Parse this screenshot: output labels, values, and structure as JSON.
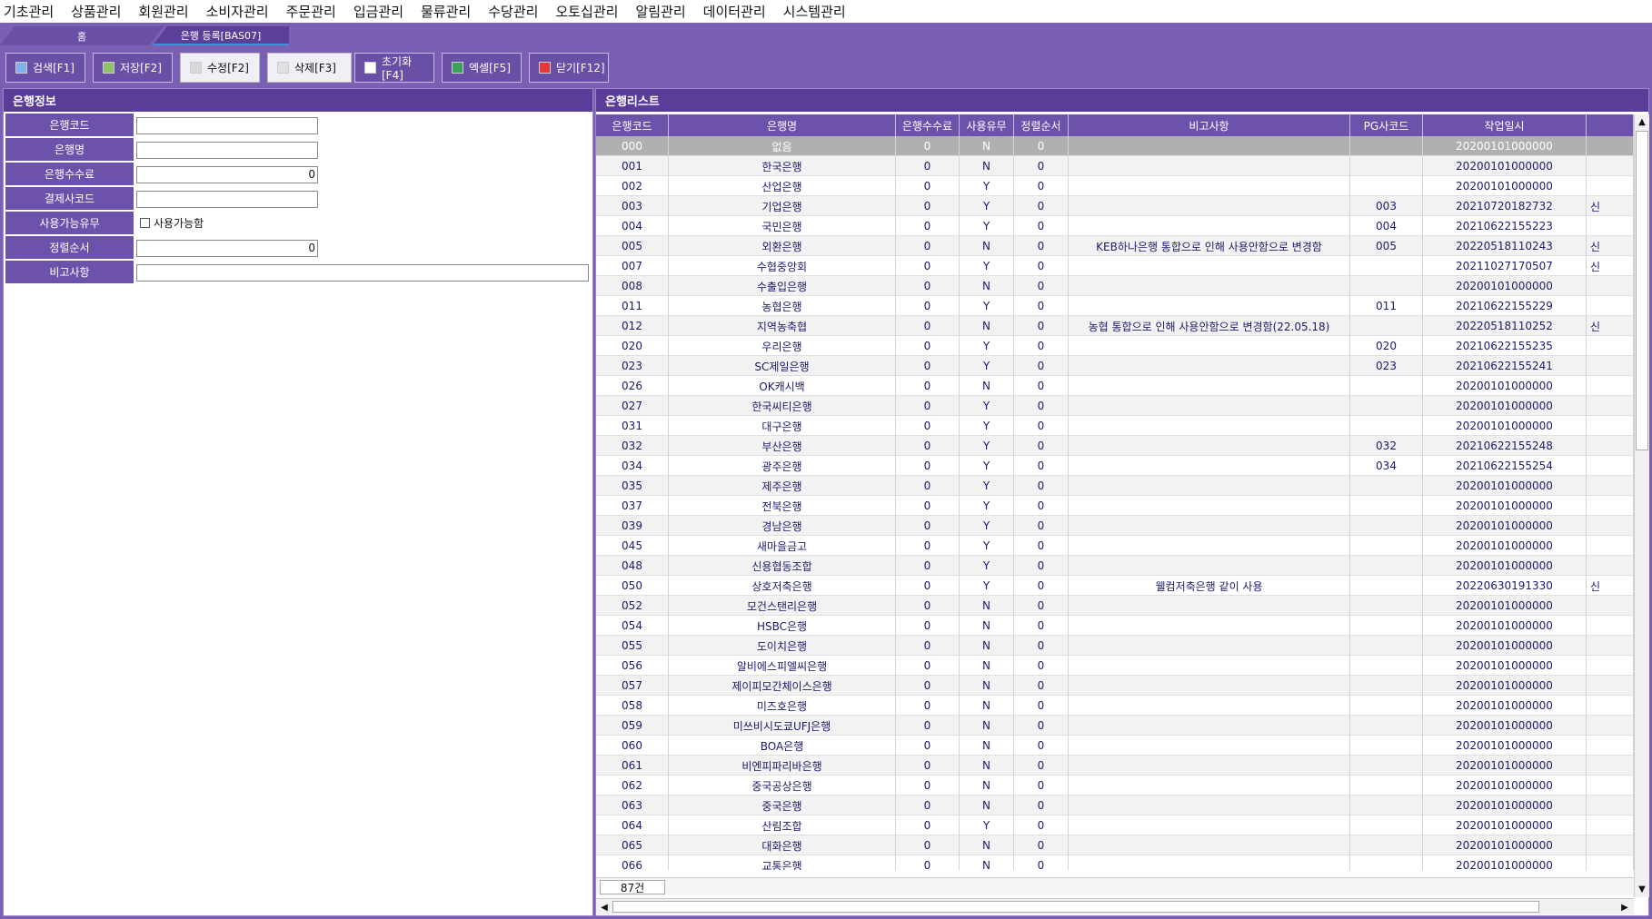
{
  "menu": [
    "기초관리",
    "상품관리",
    "회원관리",
    "소비자관리",
    "주문관리",
    "입금관리",
    "물류관리",
    "수당관리",
    "오토십관리",
    "알림관리",
    "데이터관리",
    "시스템관리"
  ],
  "tabs": {
    "home": "홈",
    "bank": "은행 등록[BAS07]"
  },
  "toolbar": [
    {
      "label": "검색[F1]",
      "icon": "search-icon"
    },
    {
      "label": "저장[F2]",
      "icon": "save-icon"
    },
    {
      "label": "수정[F2]",
      "icon": "edit-icon"
    },
    {
      "label": "삭제[F3]",
      "icon": "eraser-icon"
    },
    {
      "label": "초기화[F4]",
      "icon": "reset-icon"
    },
    {
      "label": "엑셀[F5]",
      "icon": "excel-icon"
    },
    {
      "label": "닫기[F12]",
      "icon": "close-icon"
    }
  ],
  "left_panel": {
    "title": "은행정보",
    "fields": {
      "bank_code": {
        "label": "은행코드",
        "value": ""
      },
      "bank_name": {
        "label": "은행명",
        "value": ""
      },
      "fee": {
        "label": "은행수수료",
        "value": "0"
      },
      "pay_code": {
        "label": "결제사코드",
        "value": ""
      },
      "use_yn": {
        "label": "사용가능유무",
        "check_label": "사용가능함"
      },
      "sort": {
        "label": "정렬순서",
        "value": "0"
      },
      "remark": {
        "label": "비고사항",
        "value": ""
      }
    }
  },
  "right_panel": {
    "title": "은행리스트",
    "columns": [
      "은행코드",
      "은행명",
      "은행수수료",
      "사용유무",
      "정렬순서",
      "비고사항",
      "PG사코드",
      "작업일시",
      ""
    ],
    "rows": [
      [
        "000",
        "없음",
        "0",
        "N",
        "0",
        "",
        "",
        "20200101000000",
        ""
      ],
      [
        "001",
        "한국은행",
        "0",
        "N",
        "0",
        "",
        "",
        "20200101000000",
        ""
      ],
      [
        "002",
        "산업은행",
        "0",
        "Y",
        "0",
        "",
        "",
        "20200101000000",
        ""
      ],
      [
        "003",
        "기업은행",
        "0",
        "Y",
        "0",
        "",
        "003",
        "20210720182732",
        "신"
      ],
      [
        "004",
        "국민은행",
        "0",
        "Y",
        "0",
        "",
        "004",
        "20210622155223",
        ""
      ],
      [
        "005",
        "외환은행",
        "0",
        "N",
        "0",
        "KEB하나은행 통합으로 인해 사용안함으로 변경함",
        "005",
        "20220518110243",
        "신"
      ],
      [
        "007",
        "수협중앙회",
        "0",
        "Y",
        "0",
        "",
        "",
        "20211027170507",
        "신"
      ],
      [
        "008",
        "수출입은행",
        "0",
        "N",
        "0",
        "",
        "",
        "20200101000000",
        ""
      ],
      [
        "011",
        "농협은행",
        "0",
        "Y",
        "0",
        "",
        "011",
        "20210622155229",
        ""
      ],
      [
        "012",
        "지역농축협",
        "0",
        "N",
        "0",
        "농협 통합으로 인해 사용안함으로 변경함(22.05.18)",
        "",
        "20220518110252",
        "신"
      ],
      [
        "020",
        "우리은행",
        "0",
        "Y",
        "0",
        "",
        "020",
        "20210622155235",
        ""
      ],
      [
        "023",
        "SC제일은행",
        "0",
        "Y",
        "0",
        "",
        "023",
        "20210622155241",
        ""
      ],
      [
        "026",
        "OK캐시백",
        "0",
        "N",
        "0",
        "",
        "",
        "20200101000000",
        ""
      ],
      [
        "027",
        "한국씨티은행",
        "0",
        "Y",
        "0",
        "",
        "",
        "20200101000000",
        ""
      ],
      [
        "031",
        "대구은행",
        "0",
        "Y",
        "0",
        "",
        "",
        "20200101000000",
        ""
      ],
      [
        "032",
        "부산은행",
        "0",
        "Y",
        "0",
        "",
        "032",
        "20210622155248",
        ""
      ],
      [
        "034",
        "광주은행",
        "0",
        "Y",
        "0",
        "",
        "034",
        "20210622155254",
        ""
      ],
      [
        "035",
        "제주은행",
        "0",
        "Y",
        "0",
        "",
        "",
        "20200101000000",
        ""
      ],
      [
        "037",
        "전북은행",
        "0",
        "Y",
        "0",
        "",
        "",
        "20200101000000",
        ""
      ],
      [
        "039",
        "경남은행",
        "0",
        "Y",
        "0",
        "",
        "",
        "20200101000000",
        ""
      ],
      [
        "045",
        "새마을금고",
        "0",
        "Y",
        "0",
        "",
        "",
        "20200101000000",
        ""
      ],
      [
        "048",
        "신용협동조합",
        "0",
        "Y",
        "0",
        "",
        "",
        "20200101000000",
        ""
      ],
      [
        "050",
        "상호저축은행",
        "0",
        "Y",
        "0",
        "웰컴저축은행 같이 사용",
        "",
        "20220630191330",
        "신"
      ],
      [
        "052",
        "모건스탠리은행",
        "0",
        "N",
        "0",
        "",
        "",
        "20200101000000",
        ""
      ],
      [
        "054",
        "HSBC은행",
        "0",
        "N",
        "0",
        "",
        "",
        "20200101000000",
        ""
      ],
      [
        "055",
        "도이치은행",
        "0",
        "N",
        "0",
        "",
        "",
        "20200101000000",
        ""
      ],
      [
        "056",
        "알비에스피엘씨은행",
        "0",
        "N",
        "0",
        "",
        "",
        "20200101000000",
        ""
      ],
      [
        "057",
        "제이피모간체이스은행",
        "0",
        "N",
        "0",
        "",
        "",
        "20200101000000",
        ""
      ],
      [
        "058",
        "미즈호은행",
        "0",
        "N",
        "0",
        "",
        "",
        "20200101000000",
        ""
      ],
      [
        "059",
        "미쓰비시도쿄UFJ은행",
        "0",
        "N",
        "0",
        "",
        "",
        "20200101000000",
        ""
      ],
      [
        "060",
        "BOA은행",
        "0",
        "N",
        "0",
        "",
        "",
        "20200101000000",
        ""
      ],
      [
        "061",
        "비엔피파리바은행",
        "0",
        "N",
        "0",
        "",
        "",
        "20200101000000",
        ""
      ],
      [
        "062",
        "중국공상은행",
        "0",
        "N",
        "0",
        "",
        "",
        "20200101000000",
        ""
      ],
      [
        "063",
        "중국은행",
        "0",
        "N",
        "0",
        "",
        "",
        "20200101000000",
        ""
      ],
      [
        "064",
        "산림조합",
        "0",
        "Y",
        "0",
        "",
        "",
        "20200101000000",
        ""
      ],
      [
        "065",
        "대화은행",
        "0",
        "N",
        "0",
        "",
        "",
        "20200101000000",
        ""
      ],
      [
        "066",
        "교통은행",
        "0",
        "N",
        "0",
        "",
        "",
        "20200101000000",
        ""
      ]
    ],
    "count": "87건"
  }
}
